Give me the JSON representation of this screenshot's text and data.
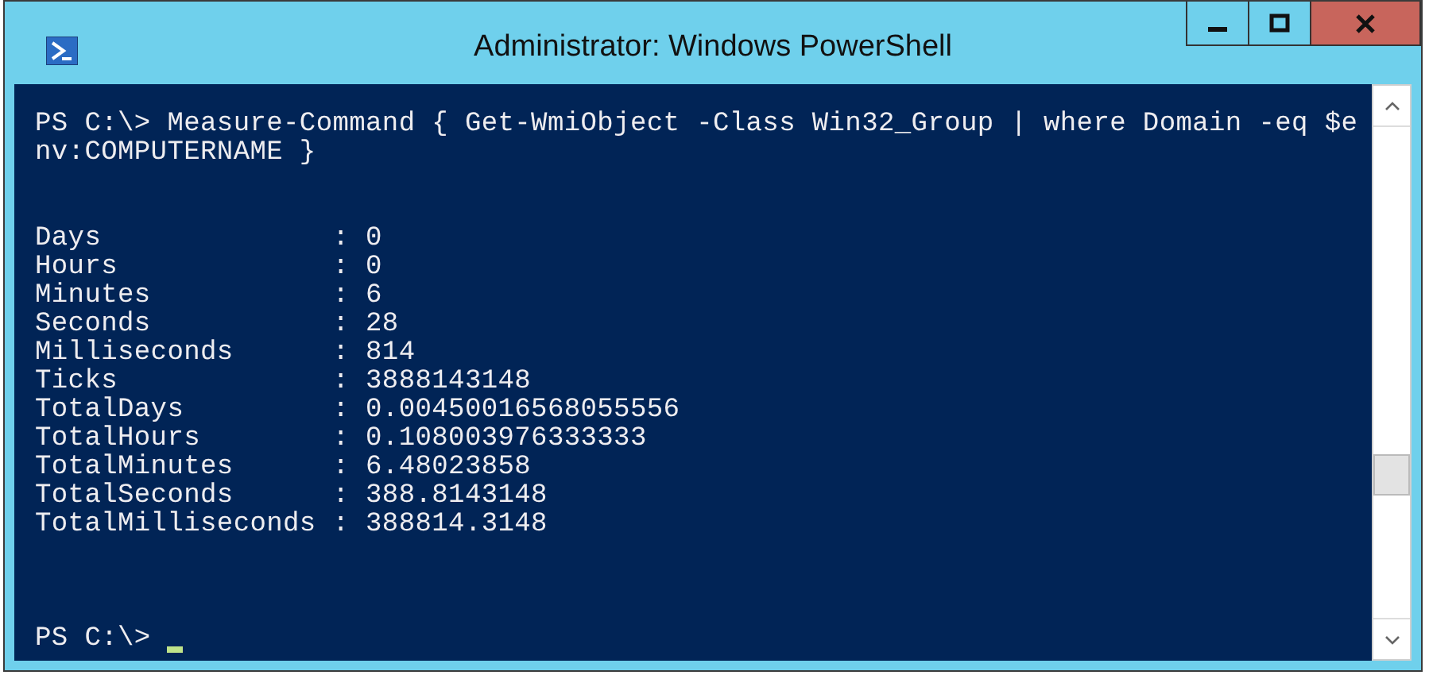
{
  "window": {
    "title": "Administrator: Windows PowerShell"
  },
  "console": {
    "command": [
      "PS C:\\> Measure-Command { Get-WmiObject -Class Win32_Group | where Domain -eq $e",
      "nv:COMPUTERNAME }"
    ],
    "output": [
      "Days              : 0",
      "Hours             : 0",
      "Minutes           : 6",
      "Seconds           : 28",
      "Milliseconds      : 814",
      "Ticks             : 3888143148",
      "TotalDays         : 0.00450016568055556",
      "TotalHours        : 0.108003976333333",
      "TotalMinutes      : 6.48023858",
      "TotalSeconds      : 388.8143148",
      "TotalMilliseconds : 388814.3148"
    ],
    "prompt": "PS C:\\>"
  }
}
